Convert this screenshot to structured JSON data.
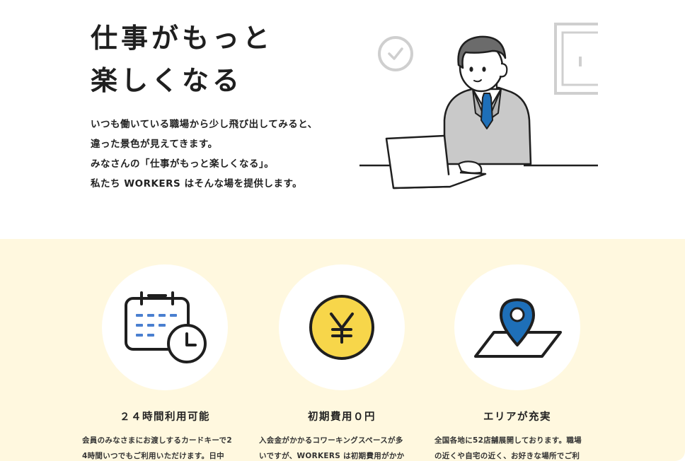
{
  "hero": {
    "title_lines": [
      "仕事がもっと",
      "楽しくなる"
    ],
    "body_lines": [
      "いつも働いている職場から少し飛び出してみると、",
      "違った景色が見えてきます。",
      "みなさんの「仕事がもっと楽しくなる」。",
      "私たち WORKERS はそんな場を提供します。"
    ],
    "illustration": "man-working-at-laptop"
  },
  "features": [
    {
      "icon": "calendar-clock-icon",
      "title": "２４時間利用可能",
      "desc_lines": [
        "会員のみなさまにお渡しするカードキーで2",
        "4時間いつでもご利用いただけます。日中"
      ]
    },
    {
      "icon": "yen-coin-icon",
      "title": "初期費用０円",
      "desc_lines": [
        "入会金がかかるコワーキングスペースが多",
        "いですが、WORKERS は初期費用がかか"
      ]
    },
    {
      "icon": "map-pin-icon",
      "title": "エリアが充実",
      "desc_lines": [
        "全国各地に52店舗展開しております。職場",
        "の近くや自宅の近く、お好きな場所でご利"
      ]
    }
  ],
  "colors": {
    "features_bg": "#fff8df",
    "coin_yellow": "#f7d64a",
    "pin_blue": "#1e6fb8",
    "tie_blue": "#1e6fb8"
  }
}
